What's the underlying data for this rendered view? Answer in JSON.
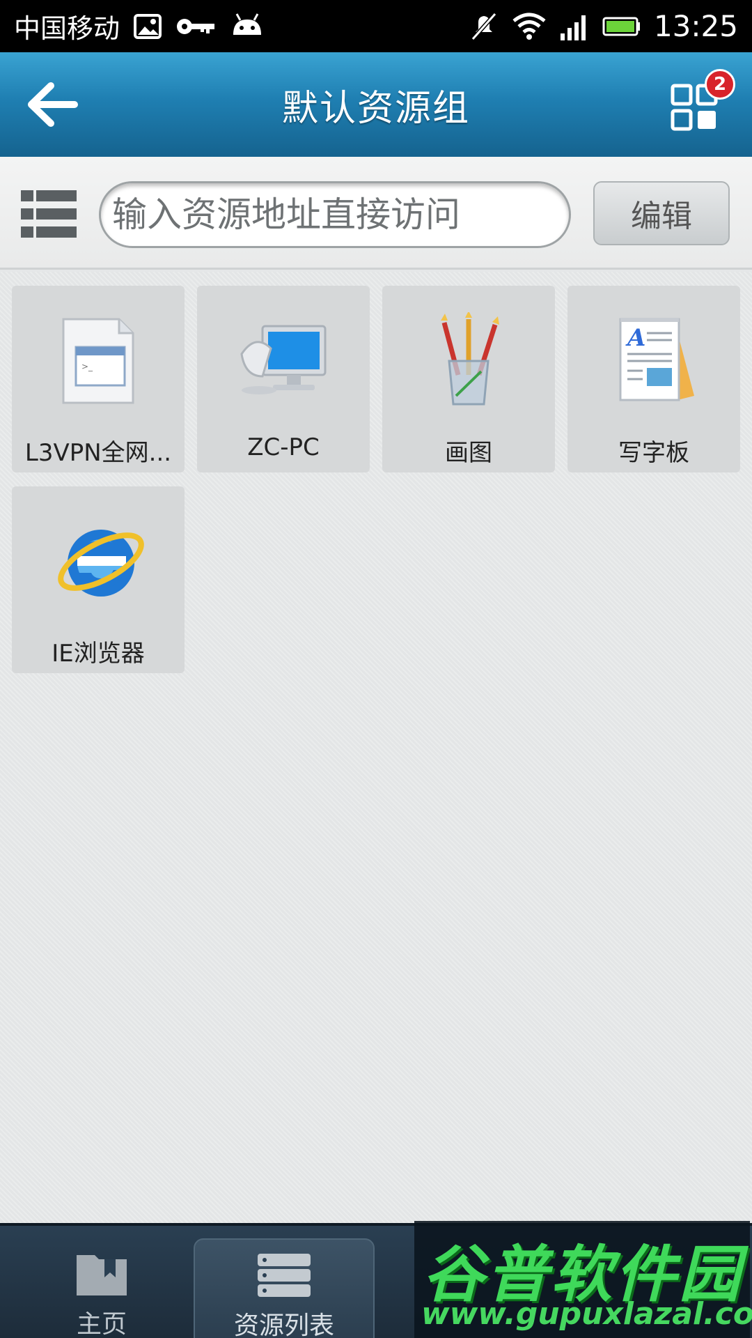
{
  "status_bar": {
    "carrier": "中国移动",
    "time": "13:25",
    "left_icons": [
      "image-icon",
      "key-icon",
      "android-icon"
    ],
    "right_icons": [
      "mute-icon",
      "wifi-icon",
      "signal-icon",
      "battery-icon"
    ]
  },
  "header": {
    "title": "默认资源组",
    "back_icon": "back-arrow-icon",
    "apps_icon": "grid-apps-icon",
    "badge_count": "2"
  },
  "search": {
    "placeholder": "输入资源地址直接访问",
    "edit_label": "编辑"
  },
  "resources": [
    {
      "label": "L3VPN全网...",
      "icon": "app-window-icon"
    },
    {
      "label": "ZC-PC",
      "icon": "remote-desktop-icon"
    },
    {
      "label": "画图",
      "icon": "paint-brushes-icon"
    },
    {
      "label": "写字板",
      "icon": "wordpad-icon"
    },
    {
      "label": "IE浏览器",
      "icon": "ie-browser-icon"
    }
  ],
  "bottom_nav": [
    {
      "label": "主页",
      "icon": "bookmark-folder-icon",
      "active": false
    },
    {
      "label": "资源列表",
      "icon": "server-list-icon",
      "active": true
    }
  ],
  "watermark": {
    "title": "谷普软件园",
    "url": "www.gupuxlazal.com"
  },
  "colors": {
    "header_top": "#3aa3d2",
    "header_bottom": "#15638f",
    "badge": "#d8232a",
    "battery": "#6cd33a",
    "watermark_green": "#3fd95a"
  }
}
